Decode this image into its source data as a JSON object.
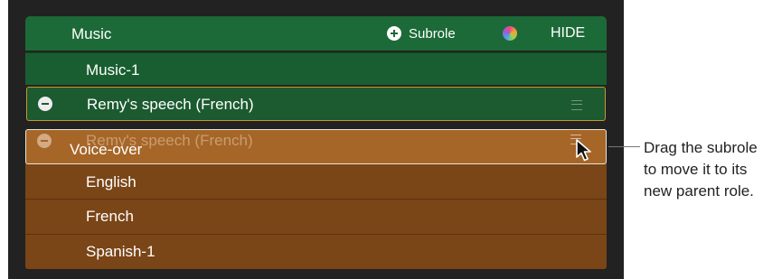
{
  "roles": {
    "music": {
      "label": "Music",
      "subrole_button": "Subrole",
      "hide_button": "HIDE",
      "subroles": [
        "Music-1"
      ],
      "dragged_subrole": "Remy's speech (French)"
    },
    "voice_over": {
      "label": "Voice-over",
      "drag_ghost_label": "Remy's speech (French)",
      "subroles": [
        "English",
        "French",
        "Spanish-1"
      ]
    }
  },
  "callout": {
    "lines": [
      "Drag the subrole",
      "to move it to its",
      "new parent role."
    ]
  },
  "colors": {
    "music_role": "#1c6a37",
    "music_subrole": "#195e31",
    "drag_outline": "#c9982a",
    "voice_over_role": "#7a4517",
    "voice_over_highlight": "#a66628"
  },
  "icons": [
    "plus-circle-icon",
    "role-color-icon",
    "minus-circle-icon",
    "drag-handle-icon",
    "arrow-cursor-icon"
  ]
}
